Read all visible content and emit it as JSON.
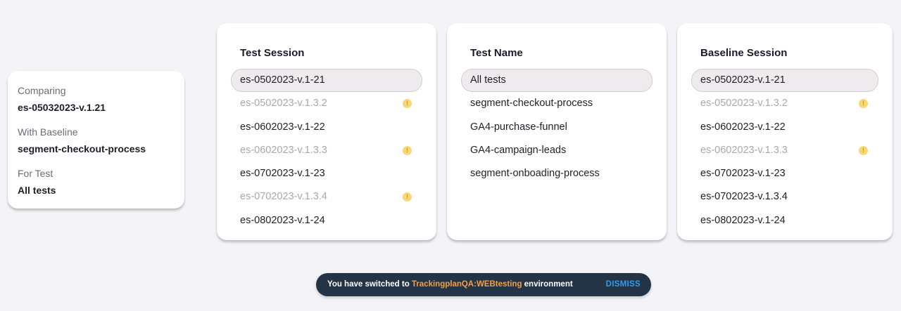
{
  "summary": {
    "comparing_label": "Comparing",
    "comparing_value": "es-05032023-v.1.21",
    "baseline_label": "With Baseline",
    "baseline_value": "segment-checkout-process",
    "test_label": "For Test",
    "test_value": "All tests"
  },
  "test_session": {
    "title": "Test Session",
    "items": [
      {
        "label": "es-0502023-v.1-21",
        "selected": true,
        "dim": false,
        "warning": false
      },
      {
        "label": "es-0502023-v.1.3.2",
        "selected": false,
        "dim": true,
        "warning": true
      },
      {
        "label": "es-0602023-v.1-22",
        "selected": false,
        "dim": false,
        "warning": false
      },
      {
        "label": "es-0602023-v.1.3.3",
        "selected": false,
        "dim": true,
        "warning": true
      },
      {
        "label": "es-0702023-v.1-23",
        "selected": false,
        "dim": false,
        "warning": false
      },
      {
        "label": "es-0702023-v.1.3.4",
        "selected": false,
        "dim": true,
        "warning": true
      },
      {
        "label": "es-0802023-v.1-24",
        "selected": false,
        "dim": false,
        "warning": false
      }
    ]
  },
  "test_name": {
    "title": "Test Name",
    "items": [
      {
        "label": "All tests",
        "selected": true
      },
      {
        "label": "segment-checkout-process",
        "selected": false
      },
      {
        "label": "GA4-purchase-funnel",
        "selected": false
      },
      {
        "label": "GA4-campaign-leads",
        "selected": false
      },
      {
        "label": "segment-onboading-process",
        "selected": false
      }
    ]
  },
  "baseline_session": {
    "title": "Baseline Session",
    "items": [
      {
        "label": "es-0502023-v.1-21",
        "selected": true,
        "dim": false,
        "warning": false
      },
      {
        "label": "es-0502023-v.1.3.2",
        "selected": false,
        "dim": true,
        "warning": true
      },
      {
        "label": "es-0602023-v.1-22",
        "selected": false,
        "dim": false,
        "warning": false
      },
      {
        "label": "es-0602023-v.1.3.3",
        "selected": false,
        "dim": true,
        "warning": true
      },
      {
        "label": "es-0702023-v.1-23",
        "selected": false,
        "dim": false,
        "warning": false
      },
      {
        "label": "es-0702023-v.1.3.4",
        "selected": false,
        "dim": false,
        "warning": false
      },
      {
        "label": "es-0802023-v.1-24",
        "selected": false,
        "dim": false,
        "warning": false
      }
    ]
  },
  "toast": {
    "prefix": "You have switched to ",
    "environment": "TrackingplanQA:WEBtesting",
    "suffix": " environment",
    "dismiss": "DISMISS"
  },
  "icons": {
    "warning": "warning-dot-icon"
  },
  "colors": {
    "background": "#f4f4f8",
    "selected_bg": "#eeeaee",
    "warning": "#f6d877",
    "toast_bg": "#243447",
    "toast_env": "#f0a04b",
    "toast_dismiss": "#2f9ee8"
  }
}
